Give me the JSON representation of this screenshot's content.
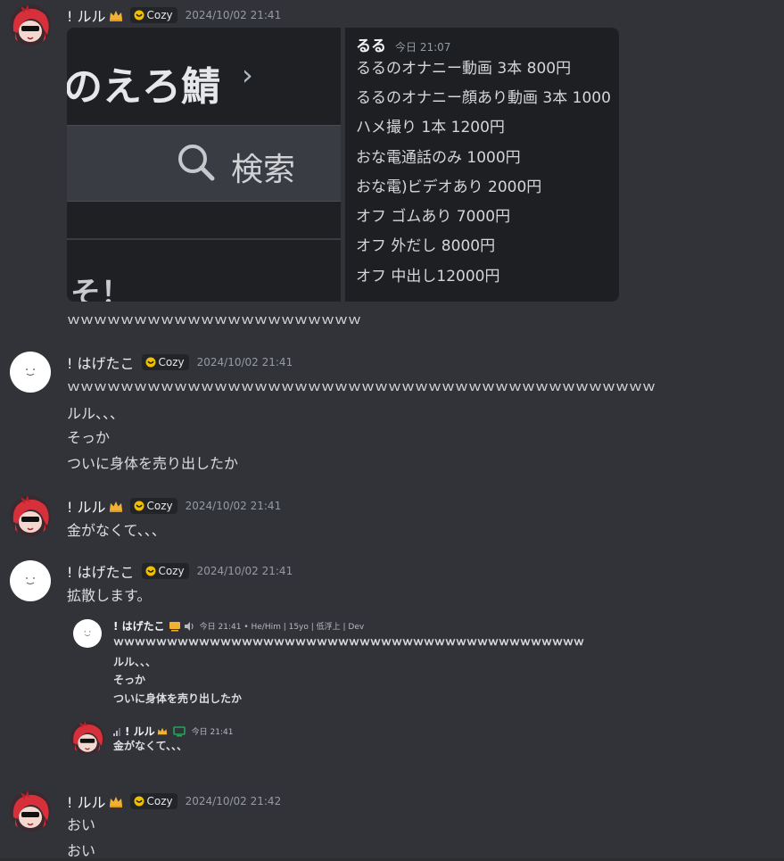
{
  "tag_label": "Cozy",
  "messages": [
    {
      "user": "! ルル",
      "time": "2024/10/02 21:41",
      "lines": [
        "ｗｗｗｗｗｗｗｗｗｗｗｗｗｗｗｗｗｗｗｗｗｗ"
      ]
    },
    {
      "user": "! はげたこ",
      "time": "2024/10/02 21:41",
      "lines": [
        "ｗｗｗｗｗｗｗｗｗｗｗｗｗｗｗｗｗｗｗｗｗｗｗｗｗｗｗｗｗｗｗｗｗｗｗｗｗｗｗｗｗｗｗｗ",
        "ルル、、、",
        "そっか",
        "ついに身体を売り出したか"
      ]
    },
    {
      "user": "! ルル",
      "time": "2024/10/02 21:41",
      "lines": [
        "金がなくて、、、"
      ]
    },
    {
      "user": "! はげたこ",
      "time": "2024/10/02 21:41",
      "lines": [
        "拡散します。"
      ]
    },
    {
      "user": "! ルル",
      "time": "2024/10/02 21:42",
      "lines": [
        "おい",
        "おい"
      ]
    }
  ],
  "embed": {
    "left_text_top": "のえろ鯖",
    "left_chevron": "›",
    "left_search": "検索",
    "left_bottom": "そ！",
    "author": "るる",
    "time": "今日 21:07",
    "items": [
      "るるのオナニー動画 3本 800円",
      "るるのオナニー顔あり動画 3本 1000",
      "ハメ撮り 1本 1200円",
      "おな電通話のみ 1000円",
      "おな電)ビデオあり 2000円",
      "オフ ゴムあり 7000円",
      "オフ 外だし 8000円",
      "オフ 中出し12000円"
    ]
  },
  "quote": {
    "user1": "! はげたこ",
    "meta1": "今日 21:41 • He/Him | 15yo | 低浮上 | Dev",
    "lines1": [
      "ｗｗｗｗｗｗｗｗｗｗｗｗｗｗｗｗｗｗｗｗｗｗｗｗｗｗｗｗｗｗｗｗｗｗｗｗｗｗｗｗｗｗｗｗ",
      "ルル、、、",
      "そっか",
      "ついに身体を売り出したか"
    ],
    "user2": "! ルル",
    "meta2": "今日 21:41",
    "lines2": [
      "金がなくて、、、"
    ]
  },
  "colors": {
    "background": "#323339",
    "timestamp": "#949ba4",
    "crown": "#f0b232",
    "online": "#23a55a"
  }
}
